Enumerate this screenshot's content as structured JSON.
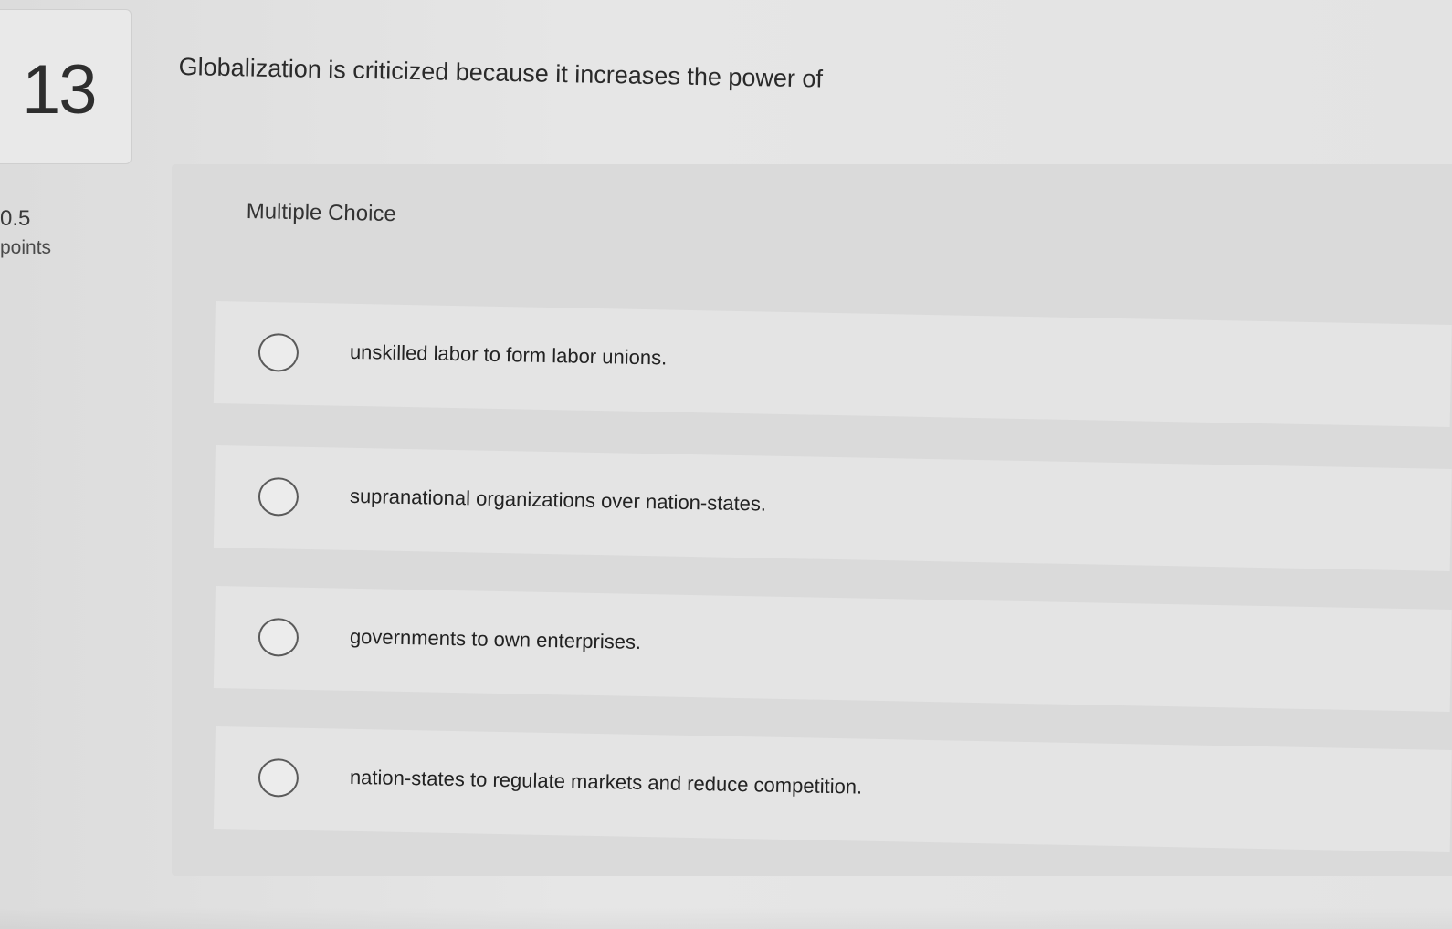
{
  "question": {
    "number": "13",
    "points_value": "0.5",
    "points_label": "points",
    "text": "Globalization is criticized because it increases the power of",
    "type": "Multiple Choice"
  },
  "options": [
    {
      "label": "unskilled labor to form labor unions."
    },
    {
      "label": "supranational organizations over nation-states."
    },
    {
      "label": "governments to own enterprises."
    },
    {
      "label": "nation-states to regulate markets and reduce competition."
    }
  ]
}
